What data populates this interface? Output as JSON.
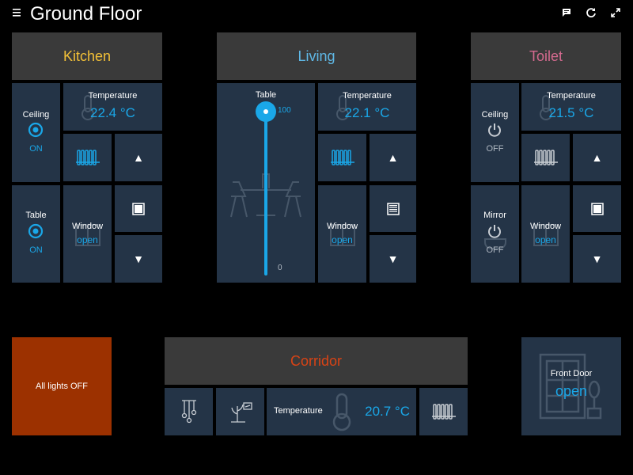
{
  "page": {
    "title": "Ground Floor"
  },
  "icons": {
    "menu": "menu-icon",
    "chat": "chat-icon",
    "refresh": "refresh-icon",
    "fullscreen": "fullscreen-icon"
  },
  "colors": {
    "accent": "#1aa7e8",
    "kitchen": "#f2c037",
    "living": "#5fb8e6",
    "toilet": "#d46a8f",
    "corridor": "#d84315",
    "all_lights_bg": "#9c3100",
    "tile_bg": "#243447",
    "header_bg": "#3a3a3a"
  },
  "kitchen": {
    "title": "Kitchen",
    "ceiling": {
      "label": "Ceiling",
      "state": "ON"
    },
    "temperature": {
      "label": "Temperature",
      "value": "22.4 °C"
    },
    "table": {
      "label": "Table",
      "state": "ON"
    },
    "window": {
      "label": "Window",
      "state": "open"
    },
    "up_arrow": "▲",
    "down_arrow": "▼"
  },
  "living": {
    "title": "Living",
    "table_dimmer": {
      "label": "Table",
      "max": "100",
      "min": "0",
      "level": 100
    },
    "temperature": {
      "label": "Temperature",
      "value": "22.1 °C"
    },
    "window": {
      "label": "Window",
      "state": "open"
    },
    "up_arrow": "▲",
    "down_arrow": "▼"
  },
  "toilet": {
    "title": "Toilet",
    "ceiling": {
      "label": "Ceiling",
      "state": "OFF"
    },
    "temperature": {
      "label": "Temperature",
      "value": "21.5 °C"
    },
    "mirror": {
      "label": "Mirror",
      "state": "OFF"
    },
    "window": {
      "label": "Window",
      "state": "open"
    },
    "up_arrow": "▲",
    "down_arrow": "▼"
  },
  "all_lights": {
    "label": "All lights OFF"
  },
  "corridor": {
    "title": "Corridor",
    "temperature": {
      "label": "Temperature",
      "value": "20.7 °C"
    }
  },
  "front_door": {
    "label": "Front Door",
    "state": "open"
  }
}
